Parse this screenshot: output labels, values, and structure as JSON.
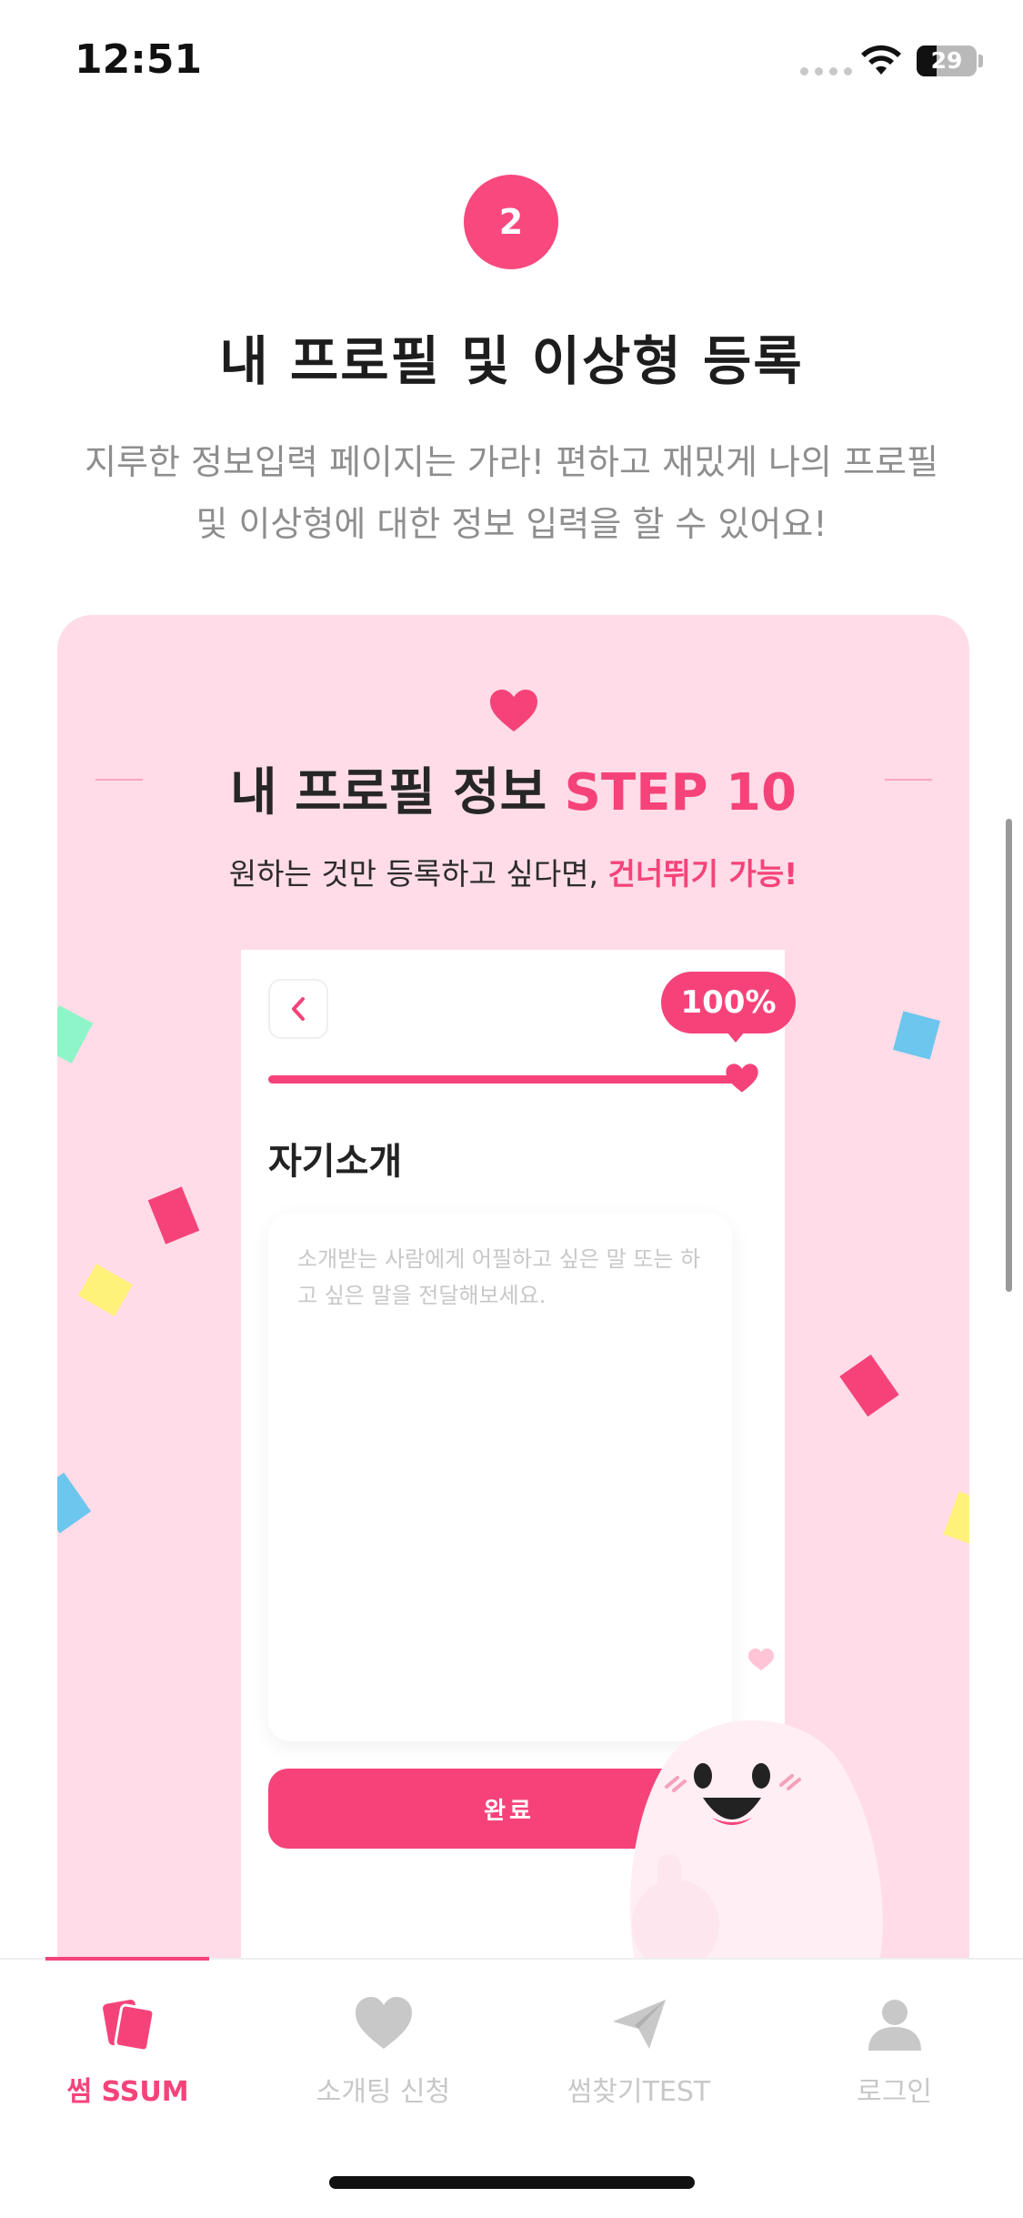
{
  "status": {
    "time": "12:51",
    "battery": "29"
  },
  "header": {
    "step_number": "2",
    "title": "내 프로필 및 이상형 등록",
    "description": "지루한 정보입력 페이지는 가라! 편하고 재밌게 나의 프로필 및 이상형에 대한 정보 입력을 할 수 있어요!"
  },
  "card": {
    "title_prefix": "내 프로필 정보 ",
    "title_accent": "STEP 10",
    "subtitle_prefix": "원하는 것만 등록하고 싶다면, ",
    "subtitle_accent": "건너뛰기 가능!"
  },
  "preview": {
    "progress_label": "100%",
    "progress_value": 1.0,
    "section_label": "자기소개",
    "textarea_placeholder": "소개받는 사람에게 어필하고 싶은 말 또는 하고 싶은 말을 전달해보세요.",
    "complete_label": "완료"
  },
  "tabs": [
    {
      "label": "썸 SSUM",
      "icon": "cards-icon",
      "active": true
    },
    {
      "label": "소개팅 신청",
      "icon": "heart-icon",
      "active": false
    },
    {
      "label": "썸찾기TEST",
      "icon": "paper-plane-icon",
      "active": false
    },
    {
      "label": "로그인",
      "icon": "person-icon",
      "active": false
    }
  ],
  "colors": {
    "accent": "#f5437a",
    "card_bg": "#ffdce7",
    "inactive": "#c8c8c8"
  }
}
